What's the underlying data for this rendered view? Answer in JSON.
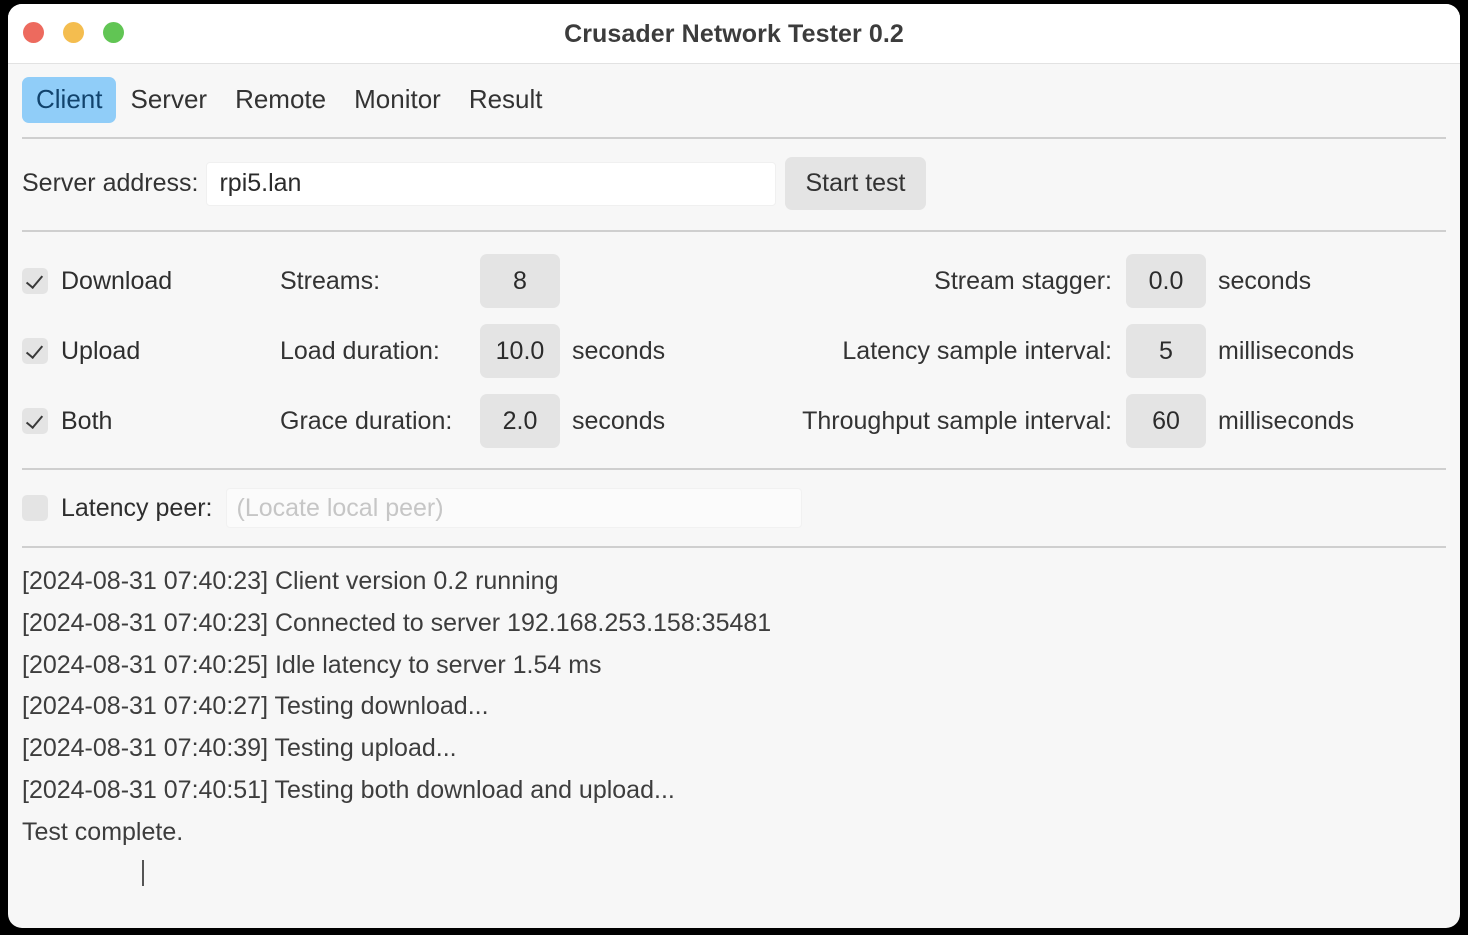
{
  "window": {
    "title": "Crusader Network Tester 0.2",
    "traffic_lights": [
      "close",
      "minimize",
      "zoom"
    ],
    "colors": {
      "close": "#ed6a5e",
      "minimize": "#f4bd4f",
      "zoom": "#61c554",
      "active_tab_bg": "#90cdf8",
      "active_tab_text": "#11436d",
      "control_bg": "#e4e4e4"
    }
  },
  "tabs": [
    {
      "label": "Client",
      "active": true
    },
    {
      "label": "Server",
      "active": false
    },
    {
      "label": "Remote",
      "active": false
    },
    {
      "label": "Monitor",
      "active": false
    },
    {
      "label": "Result",
      "active": false
    }
  ],
  "server": {
    "label": "Server address:",
    "value": "rpi5.lan",
    "placeholder": "",
    "start_button": "Start test"
  },
  "options": {
    "checkboxes": [
      {
        "label": "Download",
        "checked": true
      },
      {
        "label": "Upload",
        "checked": true
      },
      {
        "label": "Both",
        "checked": true
      }
    ],
    "left_fields": [
      {
        "label": "Streams:",
        "value": "8",
        "unit": ""
      },
      {
        "label": "Load duration:",
        "value": "10.0",
        "unit": "seconds"
      },
      {
        "label": "Grace duration:",
        "value": "2.0",
        "unit": "seconds"
      }
    ],
    "right_fields": [
      {
        "label": "Stream stagger:",
        "value": "0.0",
        "unit": "seconds"
      },
      {
        "label": "Latency sample interval:",
        "value": "5",
        "unit": "milliseconds"
      },
      {
        "label": "Throughput sample interval:",
        "value": "60",
        "unit": "milliseconds"
      }
    ]
  },
  "latency_peer": {
    "label": "Latency peer:",
    "checked": false,
    "value": "",
    "placeholder": "(Locate local peer)"
  },
  "log": {
    "lines": [
      "[2024-08-31 07:40:23] Client version 0.2 running",
      "[2024-08-31 07:40:23] Connected to server 192.168.253.158:35481",
      "[2024-08-31 07:40:25] Idle latency to server 1.54 ms",
      "[2024-08-31 07:40:27] Testing download...",
      "[2024-08-31 07:40:39] Testing upload...",
      "[2024-08-31 07:40:51] Testing both download and upload...",
      "Test complete."
    ]
  }
}
